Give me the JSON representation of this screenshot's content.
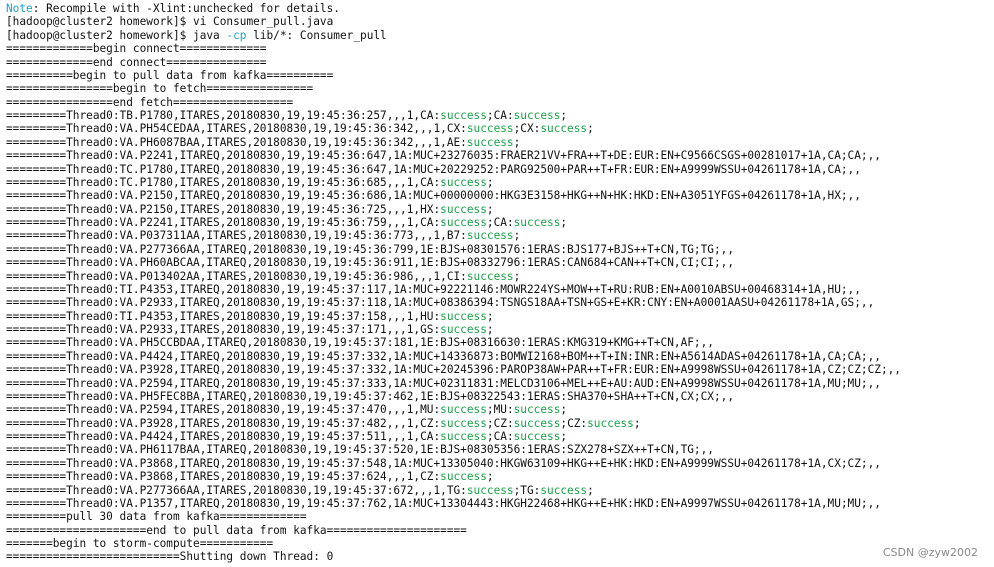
{
  "colors": {
    "background": "#ffffff",
    "text": "#111111",
    "note": "#1aa3c8",
    "flag": "#1aa3c8",
    "success": "#1aa34a",
    "watermark": "#8a8a8a"
  },
  "watermark": "CSDN @zyw2002",
  "lines": [
    [
      {
        "t": "Note",
        "c": "cyan"
      },
      {
        "t": ": Recompile with -Xlint:unchecked for details."
      }
    ],
    [
      {
        "t": "[hadoop@cluster2 homework]$ vi Consumer_pull.java"
      }
    ],
    [
      {
        "t": "[hadoop@cluster2 homework]$ java "
      },
      {
        "t": "-cp",
        "c": "cyan"
      },
      {
        "t": " lib/*: Consumer_pull"
      }
    ],
    [
      {
        "t": "=============begin connect============="
      }
    ],
    [
      {
        "t": "=============end connect==============="
      }
    ],
    [
      {
        "t": "==========begin to pull data from kafka=========="
      }
    ],
    [
      {
        "t": "================begin to fetch================"
      }
    ],
    [
      {
        "t": "================end fetch=================="
      }
    ],
    [
      {
        "t": "=========Thread0:TB.P1780,ITARES,20180830,19,19:45:36:257,,,1,CA:"
      },
      {
        "t": "success",
        "c": "green"
      },
      {
        "t": ";CA:"
      },
      {
        "t": "success",
        "c": "green"
      },
      {
        "t": ";"
      }
    ],
    [
      {
        "t": "=========Thread0:VA.PH54CEDAA,ITARES,20180830,19,19:45:36:342,,,1,CX:"
      },
      {
        "t": "success",
        "c": "green"
      },
      {
        "t": ";CX:"
      },
      {
        "t": "success",
        "c": "green"
      },
      {
        "t": ";"
      }
    ],
    [
      {
        "t": "=========Thread0:VA.PH6087BAA,ITARES,20180830,19,19:45:36:342,,,1,AE:"
      },
      {
        "t": "success",
        "c": "green"
      },
      {
        "t": ";"
      }
    ],
    [
      {
        "t": "=========Thread0:VA.P2241,ITAREQ,20180830,19,19:45:36:647,1A:MUC+23276035:FRAER21VV+FRA++T+DE:EUR:EN+C9566CSGS+00281017+1A,CA;CA;,,"
      }
    ],
    [
      {
        "t": "=========Thread0:TC.P1780,ITAREQ,20180830,19,19:45:36:647,1A:MUC+20229252:PARG92500+PAR++T+FR:EUR:EN+A9999WSSU+04261178+1A,CA;,,"
      }
    ],
    [
      {
        "t": "=========Thread0:TC.P1780,ITARES,20180830,19,19:45:36:685,,,1,CA:"
      },
      {
        "t": "success",
        "c": "green"
      },
      {
        "t": ";"
      }
    ],
    [
      {
        "t": "=========Thread0:VA.P2150,ITAREQ,20180830,19,19:45:36:686,1A:MUC+00000000:HKG3E3158+HKG++N+HK:HKD:EN+A3051YFGS+04261178+1A,HX;,,"
      }
    ],
    [
      {
        "t": "=========Thread0:VA.P2150,ITARES,20180830,19,19:45:36:725,,,1,HX:"
      },
      {
        "t": "success",
        "c": "green"
      },
      {
        "t": ";"
      }
    ],
    [
      {
        "t": "=========Thread0:VA.P2241,ITARES,20180830,19,19:45:36:759,,,1,CA:"
      },
      {
        "t": "success",
        "c": "green"
      },
      {
        "t": ";CA:"
      },
      {
        "t": "success",
        "c": "green"
      },
      {
        "t": ";"
      }
    ],
    [
      {
        "t": "=========Thread0:VA.P037311AA,ITARES,20180830,19,19:45:36:773,,,1,B7:"
      },
      {
        "t": "success",
        "c": "green"
      },
      {
        "t": ";"
      }
    ],
    [
      {
        "t": "=========Thread0:VA.P277366AA,ITAREQ,20180830,19,19:45:36:799,1E:BJS+08301576:1ERAS:BJS177+BJS++T+CN,TG;TG;,,"
      }
    ],
    [
      {
        "t": "=========Thread0:VA.PH60ABCAA,ITAREQ,20180830,19,19:45:36:911,1E:BJS+08332796:1ERAS:CAN684+CAN++T+CN,CI;CI;,,"
      }
    ],
    [
      {
        "t": "=========Thread0:VA.P013402AA,ITARES,20180830,19,19:45:36:986,,,1,CI:"
      },
      {
        "t": "success",
        "c": "green"
      },
      {
        "t": ";"
      }
    ],
    [
      {
        "t": "=========Thread0:TI.P4353,ITAREQ,20180830,19,19:45:37:117,1A:MUC+92221146:MOWR224YS+MOW++T+RU:RUB:EN+A0010ABSU+00468314+1A,HU;,,"
      }
    ],
    [
      {
        "t": "=========Thread0:VA.P2933,ITAREQ,20180830,19,19:45:37:118,1A:MUC+08386394:TSNGS18AA+TSN+GS+E+KR:CNY:EN+A0001AASU+04261178+1A,GS;,,"
      }
    ],
    [
      {
        "t": "=========Thread0:TI.P4353,ITARES,20180830,19,19:45:37:158,,,1,HU:"
      },
      {
        "t": "success",
        "c": "green"
      },
      {
        "t": ";"
      }
    ],
    [
      {
        "t": "=========Thread0:VA.P2933,ITARES,20180830,19,19:45:37:171,,,1,GS:"
      },
      {
        "t": "success",
        "c": "green"
      },
      {
        "t": ";"
      }
    ],
    [
      {
        "t": "=========Thread0:VA.PH5CCBDAA,ITAREQ,20180830,19,19:45:37:181,1E:BJS+08316630:1ERAS:KMG319+KMG++T+CN,AF;,,"
      }
    ],
    [
      {
        "t": "=========Thread0:VA.P4424,ITAREQ,20180830,19,19:45:37:332,1A:MUC+14336873:BOMWI2168+BOM++T+IN:INR:EN+A5614ADAS+04261178+1A,CA;CA;,,"
      }
    ],
    [
      {
        "t": "=========Thread0:VA.P3928,ITAREQ,20180830,19,19:45:37:332,1A:MUC+20245396:PAROP38AW+PAR++T+FR:EUR:EN+A9998WSSU+04261178+1A,CZ;CZ;CZ;,,"
      }
    ],
    [
      {
        "t": "=========Thread0:VA.P2594,ITAREQ,20180830,19,19:45:37:333,1A:MUC+02311831:MELCD3106+MEL++E+AU:AUD:EN+A9998WSSU+04261178+1A,MU;MU;,,"
      }
    ],
    [
      {
        "t": "=========Thread0:VA.PH5FEC8BA,ITAREQ,20180830,19,19:45:37:462,1E:BJS+08322543:1ERAS:SHA370+SHA++T+CN,CX;CX;,,"
      }
    ],
    [
      {
        "t": "=========Thread0:VA.P2594,ITARES,20180830,19,19:45:37:470,,,1,MU:"
      },
      {
        "t": "success",
        "c": "green"
      },
      {
        "t": ";MU:"
      },
      {
        "t": "success",
        "c": "green"
      },
      {
        "t": ";"
      }
    ],
    [
      {
        "t": "=========Thread0:VA.P3928,ITARES,20180830,19,19:45:37:482,,,1,CZ:"
      },
      {
        "t": "success",
        "c": "green"
      },
      {
        "t": ";CZ:"
      },
      {
        "t": "success",
        "c": "green"
      },
      {
        "t": ";CZ:"
      },
      {
        "t": "success",
        "c": "green"
      },
      {
        "t": ";"
      }
    ],
    [
      {
        "t": "=========Thread0:VA.P4424,ITARES,20180830,19,19:45:37:511,,,1,CA:"
      },
      {
        "t": "success",
        "c": "green"
      },
      {
        "t": ";CA:"
      },
      {
        "t": "success",
        "c": "green"
      },
      {
        "t": ";"
      }
    ],
    [
      {
        "t": "=========Thread0:VA.PH6117BAA,ITAREQ,20180830,19,19:45:37:520,1E:BJS+08305356:1ERAS:SZX278+SZX++T+CN,TG;,,"
      }
    ],
    [
      {
        "t": "=========Thread0:VA.P3868,ITAREQ,20180830,19,19:45:37:548,1A:MUC+13305040:HKGW63109+HKG++E+HK:HKD:EN+A9999WSSU+04261178+1A,CX;CZ;,,"
      }
    ],
    [
      {
        "t": "=========Thread0:VA.P3868,ITARES,20180830,19,19:45:37:624,,,1,CZ:"
      },
      {
        "t": "success",
        "c": "green"
      },
      {
        "t": ";"
      }
    ],
    [
      {
        "t": "=========Thread0:VA.P277366AA,ITARES,20180830,19,19:45:37:672,,,1,TG:"
      },
      {
        "t": "success",
        "c": "green"
      },
      {
        "t": ";TG:"
      },
      {
        "t": "success",
        "c": "green"
      },
      {
        "t": ";"
      }
    ],
    [
      {
        "t": "=========Thread0:VA.P1357,ITAREQ,20180830,19,19:45:37:762,1A:MUC+13304443:HKGH22468+HKG++E+HK:HKD:EN+A9997WSSU+04261178+1A,MU;MU;,,"
      }
    ],
    [
      {
        "t": "=========pull 30 data from kafka============="
      }
    ],
    [
      {
        "t": "=====================end to pull data from kafka====================="
      }
    ],
    [
      {
        "t": "=======begin to storm-compute==========="
      }
    ],
    [
      {
        "t": "==========================Shutting down Thread: 0"
      }
    ]
  ]
}
